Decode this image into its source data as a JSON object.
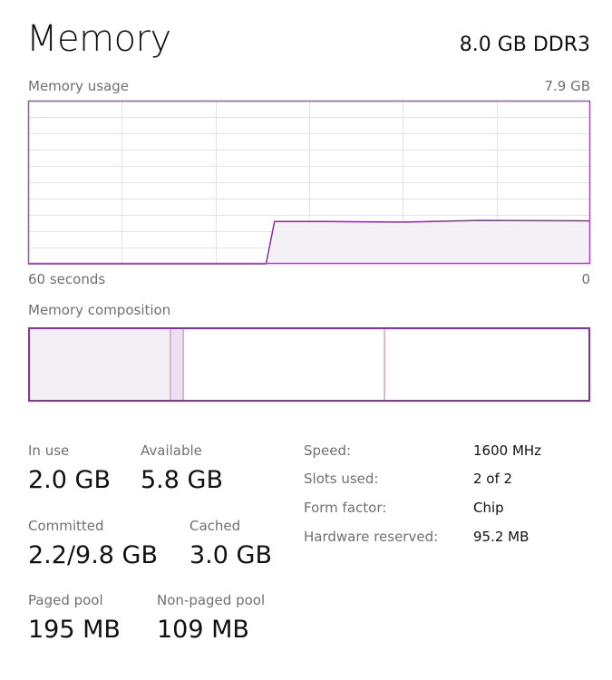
{
  "header": {
    "title": "Memory",
    "capacity": "8.0 GB DDR3"
  },
  "usage_graph": {
    "label": "Memory usage",
    "max_label": "7.9 GB",
    "time_left_label": "60 seconds",
    "time_right_label": "0"
  },
  "composition": {
    "label": "Memory composition",
    "segments": [
      {
        "name": "in-use",
        "fraction": 0.253
      },
      {
        "name": "modified",
        "fraction": 0.023
      },
      {
        "name": "standby",
        "fraction": 0.358
      },
      {
        "name": "free",
        "fraction": 0.366
      }
    ]
  },
  "stats": {
    "in_use": {
      "label": "In use",
      "value": "2.0 GB"
    },
    "available": {
      "label": "Available",
      "value": "5.8 GB"
    },
    "committed": {
      "label": "Committed",
      "value": "2.2/9.8 GB"
    },
    "cached": {
      "label": "Cached",
      "value": "3.0 GB"
    },
    "paged_pool": {
      "label": "Paged pool",
      "value": "195 MB"
    },
    "non_paged_pool": {
      "label": "Non-paged pool",
      "value": "109 MB"
    }
  },
  "details": [
    {
      "label": "Speed:",
      "value": "1600 MHz"
    },
    {
      "label": "Slots used:",
      "value": "2 of 2"
    },
    {
      "label": "Form factor:",
      "value": "Chip"
    },
    {
      "label": "Hardware reserved:",
      "value": "95.2 MB"
    }
  ],
  "colors": {
    "accent": "#8b2fa8",
    "border": "#9b4fb4",
    "fill": "#f3f0f5",
    "grid": "#e3e3e3",
    "modified_fill": "#ecdff1",
    "divider": "#c7a6d2"
  },
  "chart_data": {
    "type": "area",
    "title": "Memory usage",
    "xlabel": "",
    "ylabel": "",
    "x_range_label": [
      "60 seconds",
      "0"
    ],
    "xlim": [
      60,
      0
    ],
    "ylim": [
      0,
      7.9
    ],
    "grid": true,
    "x": [
      60,
      34.6,
      33.7,
      28,
      20,
      12,
      6,
      0
    ],
    "series": [
      {
        "name": "Memory usage (GB)",
        "values": [
          0,
          0,
          2.05,
          2.05,
          2.02,
          2.1,
          2.09,
          2.08
        ]
      }
    ]
  }
}
